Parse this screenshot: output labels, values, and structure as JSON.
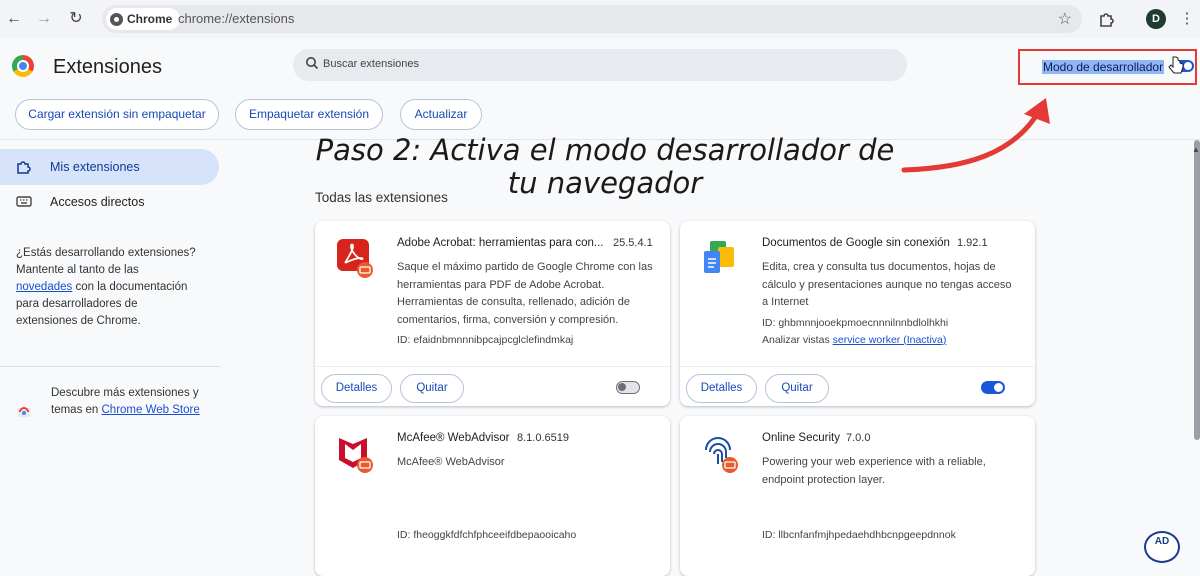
{
  "browser": {
    "chip_label": "Chrome",
    "url": "chrome://extensions",
    "profile_initial": "D"
  },
  "header": {
    "title": "Extensiones",
    "search_placeholder": "Buscar extensiones",
    "dev_mode_label": "Modo de desarrollador",
    "dev_mode_on": true,
    "buttons": {
      "load_unpacked": "Cargar extensión sin empaquetar",
      "pack": "Empaquetar extensión",
      "update": "Actualizar"
    }
  },
  "sidebar": {
    "items": [
      {
        "label": "Mis extensiones",
        "icon": "puzzle-icon",
        "active": true
      },
      {
        "label": "Accesos directos",
        "icon": "keyboard-icon",
        "active": false
      }
    ],
    "dev_text_1": "¿Estás desarrollando extensiones? Mantente al tanto de las ",
    "dev_link": "novedades",
    "dev_text_2": " con la documentación para desarrolladores de extensiones de Chrome.",
    "store_text": "Descubre más extensiones y temas en ",
    "store_link": "Chrome Web Store"
  },
  "main": {
    "section_title": "Todas las extensiones",
    "cards": [
      {
        "name": "Adobe Acrobat: herramientas para con...",
        "version": "25.5.4.1",
        "description": "Saque el máximo partido de Google Chrome con las herramientas para PDF de Adobe Acrobat. Herramientas de consulta, rellenado, adición de comentarios, firma, conversión y compresión.",
        "id": "ID: efaidnbmnnnibpcajpcglclefindmkaj",
        "details_label": "Detalles",
        "remove_label": "Quitar",
        "enabled": false,
        "icon": "adobe-acrobat-icon"
      },
      {
        "name": "Documentos de Google sin conexión",
        "version": "1.92.1",
        "description": "Edita, crea y consulta tus documentos, hojas de cálculo y presentaciones aunque no tengas acceso a Internet",
        "id": "ID: ghbmnnjooekpmoecnnnilnnbdlolhkhi",
        "inspect_prefix": "Analizar vistas ",
        "inspect_link": "service worker (Inactiva)",
        "details_label": "Detalles",
        "remove_label": "Quitar",
        "enabled": true,
        "icon": "google-docs-icon"
      },
      {
        "name": "McAfee® WebAdvisor",
        "version": "8.1.0.6519",
        "description": "McAfee® WebAdvisor",
        "id": "ID: fheoggkfdfchfphceeifdbepaooicaho",
        "icon": "mcafee-icon"
      },
      {
        "name": "Online Security",
        "version": "7.0.0",
        "description": "Powering your web experience with a reliable, endpoint protection layer.",
        "id": "ID: llbcnfanfmjhpedaehdhbcnpgeepdnnok",
        "icon": "fingerprint-shield-icon"
      }
    ]
  },
  "overlay": {
    "line1": "Paso 2: Activa el modo desarrollador de",
    "line2": "tu navegador"
  },
  "colors": {
    "accent": "#1a56db",
    "annotation_red": "#e53935"
  }
}
